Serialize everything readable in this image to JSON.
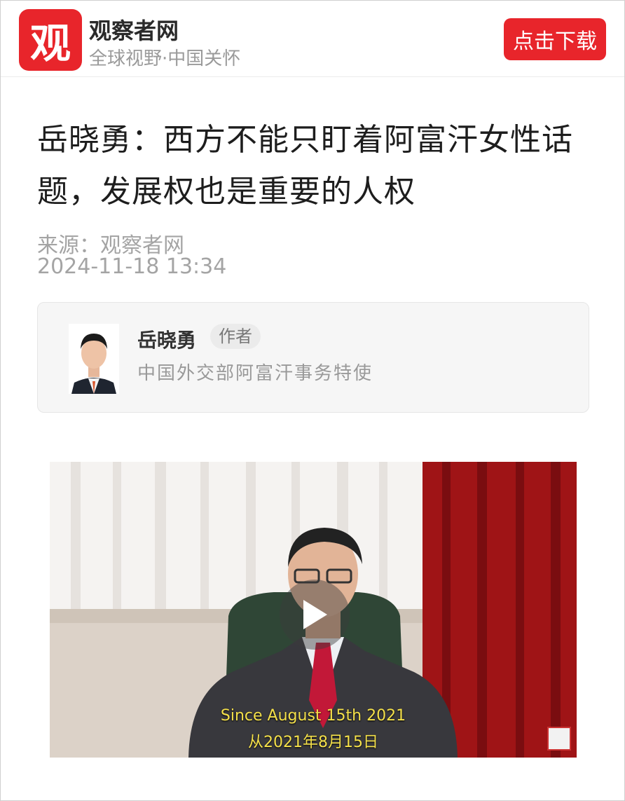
{
  "header": {
    "logo_char": "观",
    "brand": "观察者网",
    "slogan": "全球视野·中国关怀",
    "download_label": "点击下载"
  },
  "article": {
    "title": "岳晓勇：西方不能只盯着阿富汗女性话题，发展权也是重要的人权",
    "source": "来源：观察者网",
    "time": "2024-11-18 13:34"
  },
  "author": {
    "name": "岳晓勇",
    "tag": "作者",
    "role": "中国外交部阿富汗事务特使"
  },
  "video": {
    "subtitle_en": "Since August 15th 2021",
    "subtitle_cn": "从2021年8月15日"
  },
  "colors": {
    "brand_red": "#e8252b",
    "subtitle_yellow": "#f4e04a"
  }
}
